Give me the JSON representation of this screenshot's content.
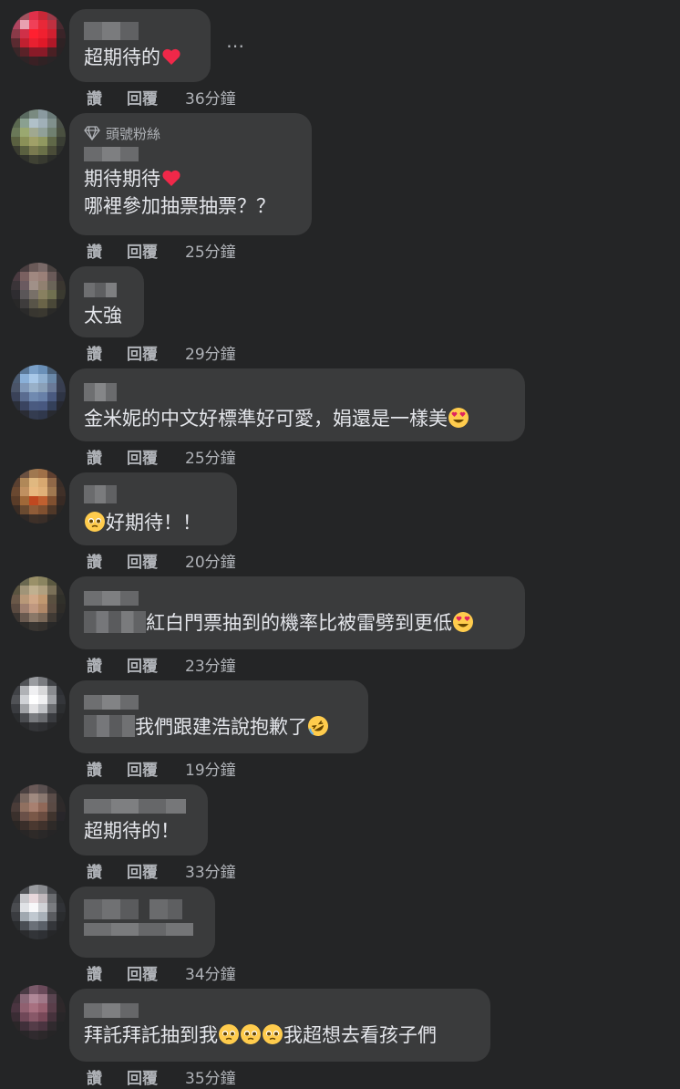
{
  "labels": {
    "like": "讚",
    "reply": "回覆"
  },
  "more_icon": "⋯",
  "comments": [
    {
      "text": "超期待的",
      "time": "36分鐘",
      "emoji": [
        "heart"
      ]
    },
    {
      "badge": "頭號粉絲",
      "text": "期待期待",
      "text2": "哪裡參加抽票抽票？？",
      "time": "25分鐘",
      "emoji": [
        "heart"
      ]
    },
    {
      "text": "太強",
      "time": "29分鐘"
    },
    {
      "text": "金米妮的中文好標準好可愛，娟還是一樣美",
      "time": "25分鐘",
      "emoji": [
        "heart-eyes"
      ]
    },
    {
      "text": "好期待！！",
      "time": "20分鐘",
      "emoji": [
        "pleading"
      ]
    },
    {
      "text": "紅白門票抽到的機率比被雷劈到更低",
      "time": "23分鐘",
      "emoji": [
        "heart-eyes"
      ]
    },
    {
      "text": "我們跟建浩說抱歉了",
      "time": "19分鐘",
      "emoji": [
        "rofl"
      ]
    },
    {
      "text": "超期待的！",
      "time": "33分鐘"
    },
    {
      "text": "",
      "time": "34分鐘"
    },
    {
      "text": "拜託拜託抽到我",
      "text_after": "我超想去看孩子們",
      "time": "35分鐘",
      "emoji": [
        "pleading",
        "pleading",
        "pleading"
      ]
    }
  ],
  "colors": {
    "background": "#242526",
    "bubble": "#3a3b3c",
    "text": "#e4e6eb",
    "muted": "#b0b3b8"
  }
}
